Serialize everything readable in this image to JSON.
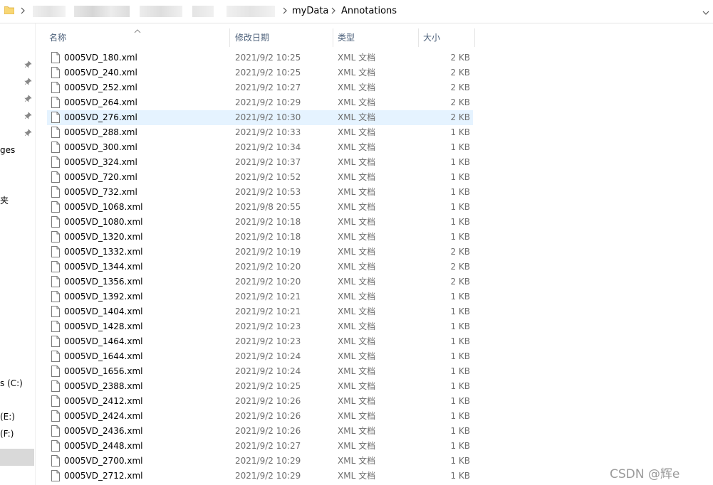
{
  "address_bar": {
    "crumbs": [
      "myData",
      "Annotations"
    ]
  },
  "nav_pane": {
    "fragments": [
      "ges",
      "夹",
      "s (C:)",
      "(E:)",
      "(F:)"
    ]
  },
  "columns": {
    "name": "名称",
    "date": "修改日期",
    "type": "类型",
    "size": "大小"
  },
  "files": [
    {
      "name": "0005VD_180.xml",
      "date": "2021/9/2 10:25",
      "type": "XML 文档",
      "size": "2 KB"
    },
    {
      "name": "0005VD_240.xml",
      "date": "2021/9/2 10:25",
      "type": "XML 文档",
      "size": "2 KB"
    },
    {
      "name": "0005VD_252.xml",
      "date": "2021/9/2 10:27",
      "type": "XML 文档",
      "size": "2 KB"
    },
    {
      "name": "0005VD_264.xml",
      "date": "2021/9/2 10:29",
      "type": "XML 文档",
      "size": "2 KB"
    },
    {
      "name": "0005VD_276.xml",
      "date": "2021/9/2 10:30",
      "type": "XML 文档",
      "size": "2 KB"
    },
    {
      "name": "0005VD_288.xml",
      "date": "2021/9/2 10:33",
      "type": "XML 文档",
      "size": "1 KB"
    },
    {
      "name": "0005VD_300.xml",
      "date": "2021/9/2 10:34",
      "type": "XML 文档",
      "size": "1 KB"
    },
    {
      "name": "0005VD_324.xml",
      "date": "2021/9/2 10:37",
      "type": "XML 文档",
      "size": "1 KB"
    },
    {
      "name": "0005VD_720.xml",
      "date": "2021/9/2 10:52",
      "type": "XML 文档",
      "size": "1 KB"
    },
    {
      "name": "0005VD_732.xml",
      "date": "2021/9/2 10:53",
      "type": "XML 文档",
      "size": "1 KB"
    },
    {
      "name": "0005VD_1068.xml",
      "date": "2021/9/8 20:55",
      "type": "XML 文档",
      "size": "1 KB"
    },
    {
      "name": "0005VD_1080.xml",
      "date": "2021/9/2 10:18",
      "type": "XML 文档",
      "size": "1 KB"
    },
    {
      "name": "0005VD_1320.xml",
      "date": "2021/9/2 10:18",
      "type": "XML 文档",
      "size": "1 KB"
    },
    {
      "name": "0005VD_1332.xml",
      "date": "2021/9/2 10:19",
      "type": "XML 文档",
      "size": "2 KB"
    },
    {
      "name": "0005VD_1344.xml",
      "date": "2021/9/2 10:20",
      "type": "XML 文档",
      "size": "2 KB"
    },
    {
      "name": "0005VD_1356.xml",
      "date": "2021/9/2 10:20",
      "type": "XML 文档",
      "size": "2 KB"
    },
    {
      "name": "0005VD_1392.xml",
      "date": "2021/9/2 10:21",
      "type": "XML 文档",
      "size": "1 KB"
    },
    {
      "name": "0005VD_1404.xml",
      "date": "2021/9/2 10:21",
      "type": "XML 文档",
      "size": "1 KB"
    },
    {
      "name": "0005VD_1428.xml",
      "date": "2021/9/2 10:23",
      "type": "XML 文档",
      "size": "1 KB"
    },
    {
      "name": "0005VD_1464.xml",
      "date": "2021/9/2 10:23",
      "type": "XML 文档",
      "size": "1 KB"
    },
    {
      "name": "0005VD_1644.xml",
      "date": "2021/9/2 10:24",
      "type": "XML 文档",
      "size": "1 KB"
    },
    {
      "name": "0005VD_1656.xml",
      "date": "2021/9/2 10:24",
      "type": "XML 文档",
      "size": "1 KB"
    },
    {
      "name": "0005VD_2388.xml",
      "date": "2021/9/2 10:25",
      "type": "XML 文档",
      "size": "1 KB"
    },
    {
      "name": "0005VD_2412.xml",
      "date": "2021/9/2 10:26",
      "type": "XML 文档",
      "size": "1 KB"
    },
    {
      "name": "0005VD_2424.xml",
      "date": "2021/9/2 10:26",
      "type": "XML 文档",
      "size": "1 KB"
    },
    {
      "name": "0005VD_2436.xml",
      "date": "2021/9/2 10:26",
      "type": "XML 文档",
      "size": "1 KB"
    },
    {
      "name": "0005VD_2448.xml",
      "date": "2021/9/2 10:27",
      "type": "XML 文档",
      "size": "1 KB"
    },
    {
      "name": "0005VD_2700.xml",
      "date": "2021/9/2 10:29",
      "type": "XML 文档",
      "size": "1 KB"
    },
    {
      "name": "0005VD_2712.xml",
      "date": "2021/9/2 10:29",
      "type": "XML 文档",
      "size": "1 KB"
    }
  ],
  "selected_row_index": 4,
  "watermark": "CSDN @辉e",
  "colors": {
    "selection": "#e5f3ff",
    "header_text": "#4c607a",
    "meta_text": "#6d6d6d",
    "folder_yellow": "#f8d775"
  }
}
